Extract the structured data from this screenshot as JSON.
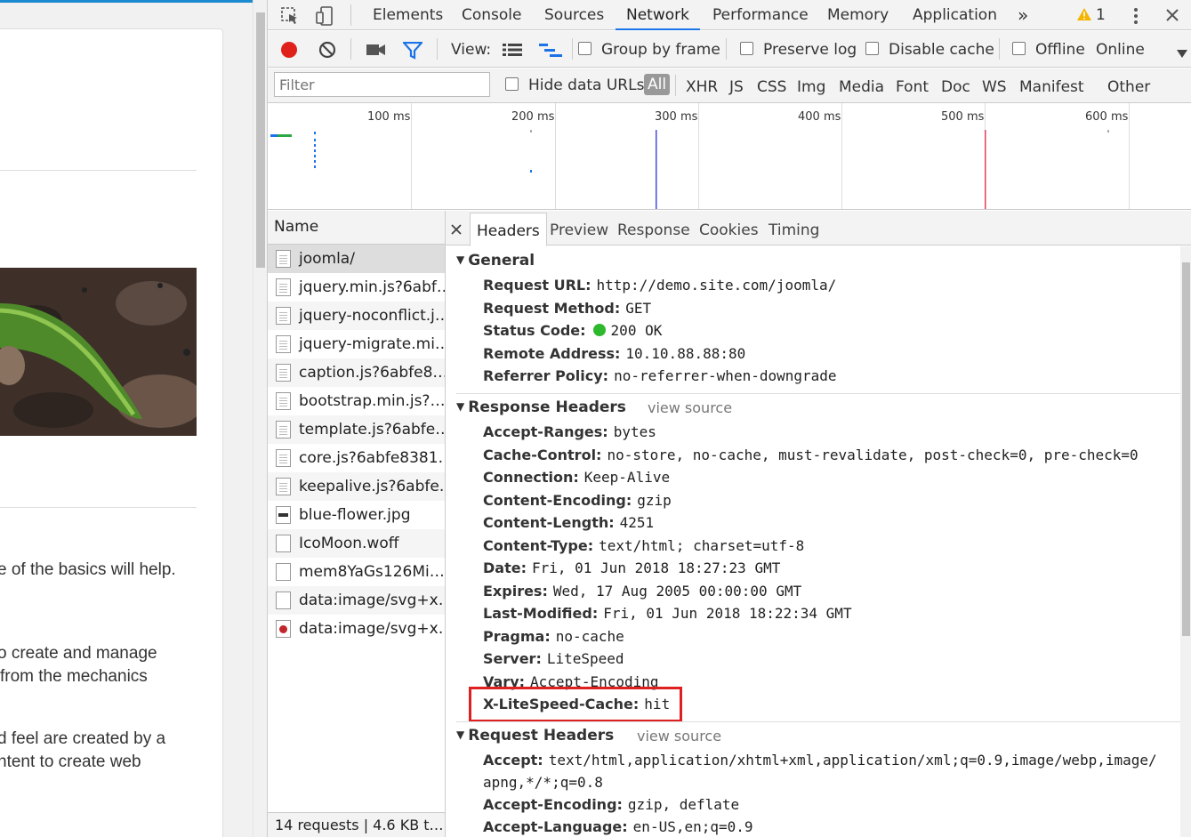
{
  "page": {
    "texts": [
      "e of the basics will help.",
      "o create and manage",
      "from the mechanics",
      "d feel are created by a",
      "ntent to create web"
    ]
  },
  "devtools": {
    "tabs": [
      "Elements",
      "Console",
      "Sources",
      "Network",
      "Performance",
      "Memory",
      "Application"
    ],
    "active_tab": "Network",
    "more_tabs": "»",
    "warning_count": "1",
    "toolbar": {
      "view_label": "View:",
      "group_by_frame": "Group by frame",
      "preserve_log": "Preserve log",
      "disable_cache": "Disable cache",
      "offline": "Offline",
      "throttle": "Online"
    },
    "filter": {
      "placeholder": "Filter",
      "hide_data_urls": "Hide data URLs",
      "types": [
        "All",
        "XHR",
        "JS",
        "CSS",
        "Img",
        "Media",
        "Font",
        "Doc",
        "WS",
        "Manifest",
        "Other"
      ]
    },
    "timeline_ticks": [
      "100 ms",
      "200 ms",
      "300 ms",
      "400 ms",
      "500 ms",
      "600 ms"
    ],
    "requests": {
      "header": "Name",
      "items": [
        {
          "name": "joomla/",
          "icon": "document-icon"
        },
        {
          "name": "jquery.min.js?6abf…",
          "icon": "document-icon"
        },
        {
          "name": "jquery-noconflict.j…",
          "icon": "document-icon"
        },
        {
          "name": "jquery-migrate.mi…",
          "icon": "document-icon"
        },
        {
          "name": "caption.js?6abfe8…",
          "icon": "document-icon"
        },
        {
          "name": "bootstrap.min.js?…",
          "icon": "document-icon"
        },
        {
          "name": "template.js?6abfe…",
          "icon": "document-icon"
        },
        {
          "name": "core.js?6abfe8381…",
          "icon": "document-icon"
        },
        {
          "name": "keepalive.js?6abfe…",
          "icon": "document-icon"
        },
        {
          "name": "blue-flower.jpg",
          "icon": "image-icon"
        },
        {
          "name": "IcoMoon.woff",
          "icon": "font-icon"
        },
        {
          "name": "mem8YaGs126Mi…",
          "icon": "font-icon"
        },
        {
          "name": "data:image/svg+x…",
          "icon": "font-icon"
        },
        {
          "name": "data:image/svg+x…",
          "icon": "svg-icon"
        }
      ],
      "footer": "14 requests  |  4.6 KB t…"
    },
    "detail_tabs": [
      "Headers",
      "Preview",
      "Response",
      "Cookies",
      "Timing"
    ],
    "general": {
      "title": "General",
      "rows": [
        {
          "name": "Request URL:",
          "value": "http://demo.site.com/joomla/"
        },
        {
          "name": "Request Method:",
          "value": "GET"
        },
        {
          "name": "Status Code:",
          "value": "200 OK"
        },
        {
          "name": "Remote Address:",
          "value": "10.10.88.88:80"
        },
        {
          "name": "Referrer Policy:",
          "value": "no-referrer-when-downgrade"
        }
      ]
    },
    "response_headers": {
      "title": "Response Headers",
      "view_source": "view source",
      "rows": [
        {
          "name": "Accept-Ranges:",
          "value": "bytes"
        },
        {
          "name": "Cache-Control:",
          "value": "no-store, no-cache, must-revalidate, post-check=0, pre-check=0"
        },
        {
          "name": "Connection:",
          "value": "Keep-Alive"
        },
        {
          "name": "Content-Encoding:",
          "value": "gzip"
        },
        {
          "name": "Content-Length:",
          "value": "4251"
        },
        {
          "name": "Content-Type:",
          "value": "text/html; charset=utf-8"
        },
        {
          "name": "Date:",
          "value": "Fri, 01 Jun 2018 18:27:23 GMT"
        },
        {
          "name": "Expires:",
          "value": "Wed, 17 Aug 2005 00:00:00 GMT"
        },
        {
          "name": "Last-Modified:",
          "value": "Fri, 01 Jun 2018 18:22:34 GMT"
        },
        {
          "name": "Pragma:",
          "value": "no-cache"
        },
        {
          "name": "Server:",
          "value": "LiteSpeed"
        },
        {
          "name": "Vary:",
          "value": "Accept-Encoding"
        },
        {
          "name": "X-LiteSpeed-Cache:",
          "value": "hit"
        }
      ]
    },
    "request_headers": {
      "title": "Request Headers",
      "view_source": "view source",
      "rows": [
        {
          "name": "Accept:",
          "value": "text/html,application/xhtml+xml,application/xml;q=0.9,image/webp,image/"
        },
        {
          "name": "",
          "value": "apng,*/*;q=0.8"
        },
        {
          "name": "Accept-Encoding:",
          "value": "gzip, deflate"
        },
        {
          "name": "Accept-Language:",
          "value": "en-US,en;q=0.9"
        }
      ]
    },
    "colors": {
      "accent": "#1a73e8",
      "record": "#e0201b",
      "status_ok": "#2db82d",
      "highlight": "#e02020",
      "load_line": "#e0405a",
      "dom_line": "#4a4ae0"
    }
  }
}
